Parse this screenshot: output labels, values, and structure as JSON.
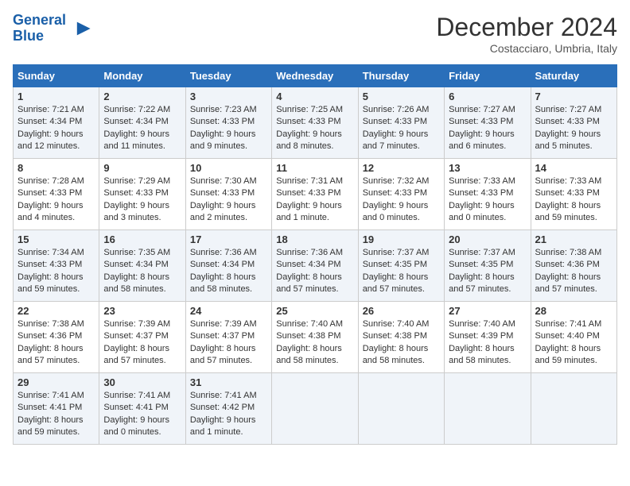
{
  "header": {
    "logo_line1": "General",
    "logo_line2": "Blue",
    "month": "December 2024",
    "location": "Costacciaro, Umbria, Italy"
  },
  "days_of_week": [
    "Sunday",
    "Monday",
    "Tuesday",
    "Wednesday",
    "Thursday",
    "Friday",
    "Saturday"
  ],
  "weeks": [
    [
      {
        "day": 1,
        "info": "Sunrise: 7:21 AM\nSunset: 4:34 PM\nDaylight: 9 hours and 12 minutes."
      },
      {
        "day": 2,
        "info": "Sunrise: 7:22 AM\nSunset: 4:34 PM\nDaylight: 9 hours and 11 minutes."
      },
      {
        "day": 3,
        "info": "Sunrise: 7:23 AM\nSunset: 4:33 PM\nDaylight: 9 hours and 9 minutes."
      },
      {
        "day": 4,
        "info": "Sunrise: 7:25 AM\nSunset: 4:33 PM\nDaylight: 9 hours and 8 minutes."
      },
      {
        "day": 5,
        "info": "Sunrise: 7:26 AM\nSunset: 4:33 PM\nDaylight: 9 hours and 7 minutes."
      },
      {
        "day": 6,
        "info": "Sunrise: 7:27 AM\nSunset: 4:33 PM\nDaylight: 9 hours and 6 minutes."
      },
      {
        "day": 7,
        "info": "Sunrise: 7:27 AM\nSunset: 4:33 PM\nDaylight: 9 hours and 5 minutes."
      }
    ],
    [
      {
        "day": 8,
        "info": "Sunrise: 7:28 AM\nSunset: 4:33 PM\nDaylight: 9 hours and 4 minutes."
      },
      {
        "day": 9,
        "info": "Sunrise: 7:29 AM\nSunset: 4:33 PM\nDaylight: 9 hours and 3 minutes."
      },
      {
        "day": 10,
        "info": "Sunrise: 7:30 AM\nSunset: 4:33 PM\nDaylight: 9 hours and 2 minutes."
      },
      {
        "day": 11,
        "info": "Sunrise: 7:31 AM\nSunset: 4:33 PM\nDaylight: 9 hours and 1 minute."
      },
      {
        "day": 12,
        "info": "Sunrise: 7:32 AM\nSunset: 4:33 PM\nDaylight: 9 hours and 0 minutes."
      },
      {
        "day": 13,
        "info": "Sunrise: 7:33 AM\nSunset: 4:33 PM\nDaylight: 9 hours and 0 minutes."
      },
      {
        "day": 14,
        "info": "Sunrise: 7:33 AM\nSunset: 4:33 PM\nDaylight: 8 hours and 59 minutes."
      }
    ],
    [
      {
        "day": 15,
        "info": "Sunrise: 7:34 AM\nSunset: 4:33 PM\nDaylight: 8 hours and 59 minutes."
      },
      {
        "day": 16,
        "info": "Sunrise: 7:35 AM\nSunset: 4:34 PM\nDaylight: 8 hours and 58 minutes."
      },
      {
        "day": 17,
        "info": "Sunrise: 7:36 AM\nSunset: 4:34 PM\nDaylight: 8 hours and 58 minutes."
      },
      {
        "day": 18,
        "info": "Sunrise: 7:36 AM\nSunset: 4:34 PM\nDaylight: 8 hours and 57 minutes."
      },
      {
        "day": 19,
        "info": "Sunrise: 7:37 AM\nSunset: 4:35 PM\nDaylight: 8 hours and 57 minutes."
      },
      {
        "day": 20,
        "info": "Sunrise: 7:37 AM\nSunset: 4:35 PM\nDaylight: 8 hours and 57 minutes."
      },
      {
        "day": 21,
        "info": "Sunrise: 7:38 AM\nSunset: 4:36 PM\nDaylight: 8 hours and 57 minutes."
      }
    ],
    [
      {
        "day": 22,
        "info": "Sunrise: 7:38 AM\nSunset: 4:36 PM\nDaylight: 8 hours and 57 minutes."
      },
      {
        "day": 23,
        "info": "Sunrise: 7:39 AM\nSunset: 4:37 PM\nDaylight: 8 hours and 57 minutes."
      },
      {
        "day": 24,
        "info": "Sunrise: 7:39 AM\nSunset: 4:37 PM\nDaylight: 8 hours and 57 minutes."
      },
      {
        "day": 25,
        "info": "Sunrise: 7:40 AM\nSunset: 4:38 PM\nDaylight: 8 hours and 58 minutes."
      },
      {
        "day": 26,
        "info": "Sunrise: 7:40 AM\nSunset: 4:38 PM\nDaylight: 8 hours and 58 minutes."
      },
      {
        "day": 27,
        "info": "Sunrise: 7:40 AM\nSunset: 4:39 PM\nDaylight: 8 hours and 58 minutes."
      },
      {
        "day": 28,
        "info": "Sunrise: 7:41 AM\nSunset: 4:40 PM\nDaylight: 8 hours and 59 minutes."
      }
    ],
    [
      {
        "day": 29,
        "info": "Sunrise: 7:41 AM\nSunset: 4:41 PM\nDaylight: 8 hours and 59 minutes."
      },
      {
        "day": 30,
        "info": "Sunrise: 7:41 AM\nSunset: 4:41 PM\nDaylight: 9 hours and 0 minutes."
      },
      {
        "day": 31,
        "info": "Sunrise: 7:41 AM\nSunset: 4:42 PM\nDaylight: 9 hours and 1 minute."
      },
      null,
      null,
      null,
      null
    ]
  ]
}
